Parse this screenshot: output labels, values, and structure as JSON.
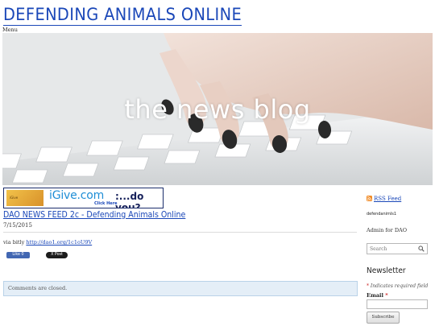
{
  "site": {
    "title": "DEFENDING ANIMALS ONLINE",
    "menu_label": "Menu",
    "brand_color": "#1a47b8"
  },
  "hero": {
    "title": "the news blog"
  },
  "banner": {
    "logo": "iGive.com",
    "tagline": ":...do you?",
    "cta": "Click Here"
  },
  "post": {
    "title": "DAO NEWS FEED 2c - Defending Animals Online",
    "date": "7/15/2015",
    "via_text": "via bitly",
    "link": "http://dao1.org/1c1oU9V",
    "like_label": "Like 0",
    "post_label": "X Post"
  },
  "comments": {
    "status": "Comments are closed."
  },
  "sidebar": {
    "rss_label": "RSS Feed",
    "author": "defendanimls1",
    "admin_text": "Admin for DAO",
    "search_placeholder": "Search",
    "newsletter": {
      "title": "Newsletter",
      "required_note": "Indicates required field",
      "email_label": "Email",
      "required_marker": "*",
      "subscribe_label": "Subscribe"
    }
  },
  "icons": [
    "rss-icon",
    "search-icon",
    "facebook-like-icon"
  ],
  "colors": {
    "link": "#1a47b8",
    "required": "#cc2222",
    "comments_bg": "#e4eef7"
  }
}
